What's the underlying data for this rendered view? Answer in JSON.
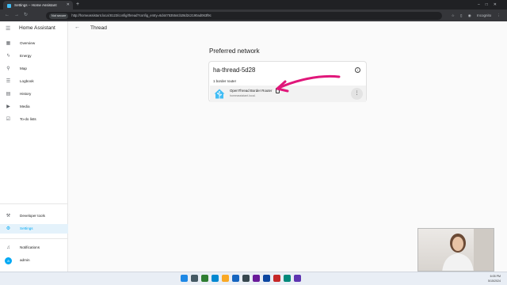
{
  "browser": {
    "tab_title": "Settings – Home Assistant",
    "new_tab": "+",
    "security_label": "Not secure",
    "url": "http://homeassistant.local:8123/config/thread?config_entry=6d44753554cb28d2c2190ad063f9c",
    "profile_label": "Incognito"
  },
  "sidebar": {
    "title": "Home Assistant",
    "items": [
      {
        "label": "Overview",
        "icon": "grid-icon"
      },
      {
        "label": "Energy",
        "icon": "lightning-icon"
      },
      {
        "label": "Map",
        "icon": "map-pin-icon"
      },
      {
        "label": "Logbook",
        "icon": "list-icon"
      },
      {
        "label": "History",
        "icon": "chart-icon"
      },
      {
        "label": "Media",
        "icon": "media-icon"
      },
      {
        "label": "To-do lists",
        "icon": "checklist-icon"
      }
    ],
    "bottom_items": [
      {
        "label": "Developer tools",
        "icon": "hammer-icon"
      },
      {
        "label": "Settings",
        "icon": "gear-icon",
        "active": true
      },
      {
        "label": "Notifications",
        "icon": "bell-icon"
      },
      {
        "label": "admin",
        "avatar": "a"
      }
    ]
  },
  "main": {
    "page_title": "Thread",
    "section_title": "Preferred network",
    "network": {
      "name": "ha-thread-5d28",
      "border_router_count": "1 border router",
      "router": {
        "name": "OpenThread Border Router",
        "host": "homeassistant.local."
      }
    }
  },
  "taskbar": {
    "time": "6:05 PM",
    "date": "5/15/2024"
  },
  "colors": {
    "accent": "#03a9f4",
    "annotation_arrow": "#e0177a"
  }
}
